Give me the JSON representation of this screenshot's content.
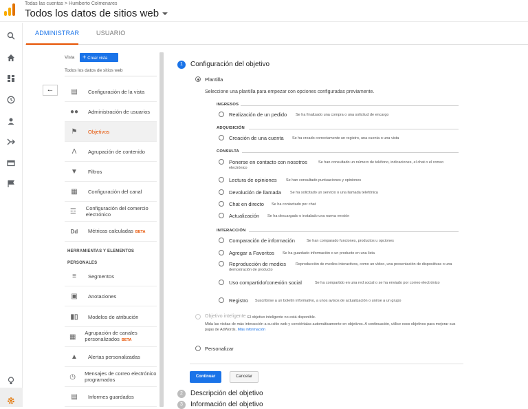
{
  "header": {
    "breadcrumb": [
      "Todas las cuentas",
      "Humberto Colmenares"
    ],
    "breadcrumb_sep": ">",
    "title": "Todos los datos de sitios web"
  },
  "left_nav": [
    "search-icon",
    "home-icon",
    "dashboard-icon",
    "clock-icon",
    "person-icon",
    "acquisition-icon",
    "behavior-icon",
    "flag-icon",
    "lightbulb-icon",
    "gear-icon"
  ],
  "tabs": [
    {
      "label": "ADMINISTRAR",
      "active": true
    },
    {
      "label": "USUARIO",
      "active": false
    }
  ],
  "vista": {
    "label": "Vista",
    "create_label": "Crear vista",
    "name": "Todos los datos de sitios web"
  },
  "menu": [
    {
      "label": "Configuración de la vista",
      "icon": "document-icon"
    },
    {
      "label": "Administración de usuarios",
      "icon": "users-icon"
    },
    {
      "label": "Objetivos",
      "icon": "flag-icon",
      "selected": true
    },
    {
      "label": "Agrupación de contenido",
      "icon": "walk-icon"
    },
    {
      "label": "Filtros",
      "icon": "filter-icon"
    },
    {
      "label": "Configuración del canal",
      "icon": "channel-icon"
    },
    {
      "label": "Configuración del comercio electrónico",
      "icon": "cart-icon"
    },
    {
      "label": "Métricas calculadas",
      "icon": "dd-icon",
      "beta": "BETA"
    }
  ],
  "tools_section": [
    "HERRAMIENTAS Y ELEMENTOS",
    "PERSONALES"
  ],
  "tools": [
    {
      "label": "Segmentos",
      "icon": "segments-icon"
    },
    {
      "label": "Anotaciones",
      "icon": "comment-icon"
    },
    {
      "label": "Modelos de atribución",
      "icon": "bars-icon"
    },
    {
      "label": "Agrupación de canales personalizados",
      "icon": "channel-icon",
      "beta": "BETA"
    },
    {
      "label": "Alertas personalizadas",
      "icon": "megaphone-icon"
    },
    {
      "label": "Mensajes de correo electrónico programados",
      "icon": "clock-icon"
    },
    {
      "label": "Informes guardados",
      "icon": "document-icon"
    }
  ],
  "goal": {
    "step1": {
      "num": "1",
      "title": "Configuración del objetivo"
    },
    "template_label": "Plantilla",
    "template_intro": "Seleccione una plantilla para empezar con opciones configuradas previamente.",
    "categories": [
      {
        "name": "INGRESOS",
        "options": [
          {
            "label": "Realización de un pedido",
            "desc": "Se ha finalizado una compra o una solicitud de encargo"
          }
        ]
      },
      {
        "name": "ADQUISICIÓN",
        "options": [
          {
            "label": "Creación de una cuenta",
            "desc": "Se ha creado correctamente un registro, una cuenta o una vista"
          }
        ]
      },
      {
        "name": "CONSULTA",
        "options": [
          {
            "label": "Ponerse en contacto con nosotros",
            "desc": "Se han consultado un número de teléfono, indicaciones, el chat o el correo electrónico"
          },
          {
            "label": "Lectura de opiniones",
            "desc": "Se han consultado puntuaciones y opiniones"
          },
          {
            "label": "Devolución de llamada",
            "desc": "Se ha solicitado un servicio o una llamada telefónica"
          },
          {
            "label": "Chat en directo",
            "desc": "Se ha contactado por chat"
          },
          {
            "label": "Actualización",
            "desc": "Se ha descargado o instalado una nueva versión"
          }
        ]
      },
      {
        "name": "INTERACCIÓN",
        "options": [
          {
            "label": "Comparación de información",
            "desc": "Se han comparado funciones, productos u opciones"
          },
          {
            "label": "Agregar a Favoritos",
            "desc": "Se ha guardado información o un producto en una lista"
          },
          {
            "label": "Reproducción de medios",
            "desc": "Reproducción de medios interactivos, como un vídeo, una presentación de dispositivas o una demostración de producto"
          },
          {
            "label": "Uso compartido/conexión social",
            "desc": "Se ha compartido en una red social o se ha enviado por correo electrónico"
          },
          {
            "label": "Registro",
            "desc": "Suscribirse a un boletín informativo, a unos avisos de actualización o unirse a un grupo"
          }
        ]
      }
    ],
    "smart": {
      "label": "Objetivo inteligente",
      "note": "El objetivo inteligente no está disponible.",
      "desc": "Mida las visitas de más interacción a su sitio web y conviértalas automáticamente en objetivos. A continuación, utilice esos objetivos para mejorar sus pujas de AdWords.",
      "link": "Más información"
    },
    "custom_label": "Personalizar",
    "continue_label": "Continuar",
    "cancel_label": "Cancelar",
    "step2": {
      "num": "2",
      "title": "Descripción del objetivo"
    },
    "step3": {
      "num": "3",
      "title": "Información del objetivo"
    }
  },
  "colors": {
    "accent": "#1a73e8",
    "orange": "#e65100"
  }
}
